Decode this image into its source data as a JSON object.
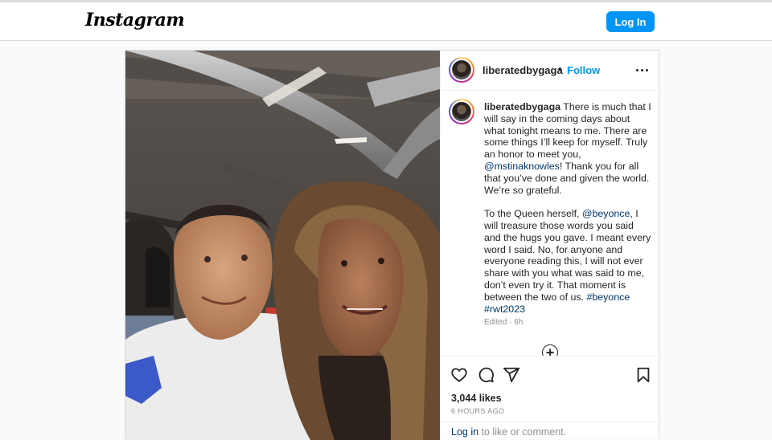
{
  "header": {
    "logo": "Instagram",
    "login_label": "Log In"
  },
  "post": {
    "username": "liberatedbygaga",
    "separator": "•",
    "follow_label": "Follow",
    "caption": {
      "username": "liberatedbygaga",
      "p1": "There is much that I will say in the coming days about what tonight means to me. There are some things I’ll keep for myself. Truly an honor to meet you, ",
      "mention1": "@mstinaknowles",
      "p1_end": "! Thank you for all that you’ve done and given the world. We’re so grateful.",
      "p2_start": "To the Queen herself, ",
      "mention2": "@beyonce",
      "p2_mid": ", I will treasure those words you said and the hugs you gave. I meant every word I said. No, for anyone and everyone reading this, I will not ever share with you what was said to me, don’t even try it. That moment is between the two of us. ",
      "hashtag1": "#beyonce",
      "hashtag2": "#rwt2023"
    },
    "edited": "Edited · 6h",
    "likes": "3,044 likes",
    "time_ago": "6 HOURS AGO",
    "comment_login": "Log in",
    "comment_rest": " to like or comment."
  },
  "icons": {
    "like": "heart-icon",
    "comment": "comment-icon",
    "share": "share-icon",
    "save": "bookmark-icon",
    "more": "more-options-icon",
    "add": "add-circle-icon"
  },
  "colors": {
    "accent": "#0095f6",
    "link": "#00376b",
    "muted": "#8e8e8e"
  }
}
